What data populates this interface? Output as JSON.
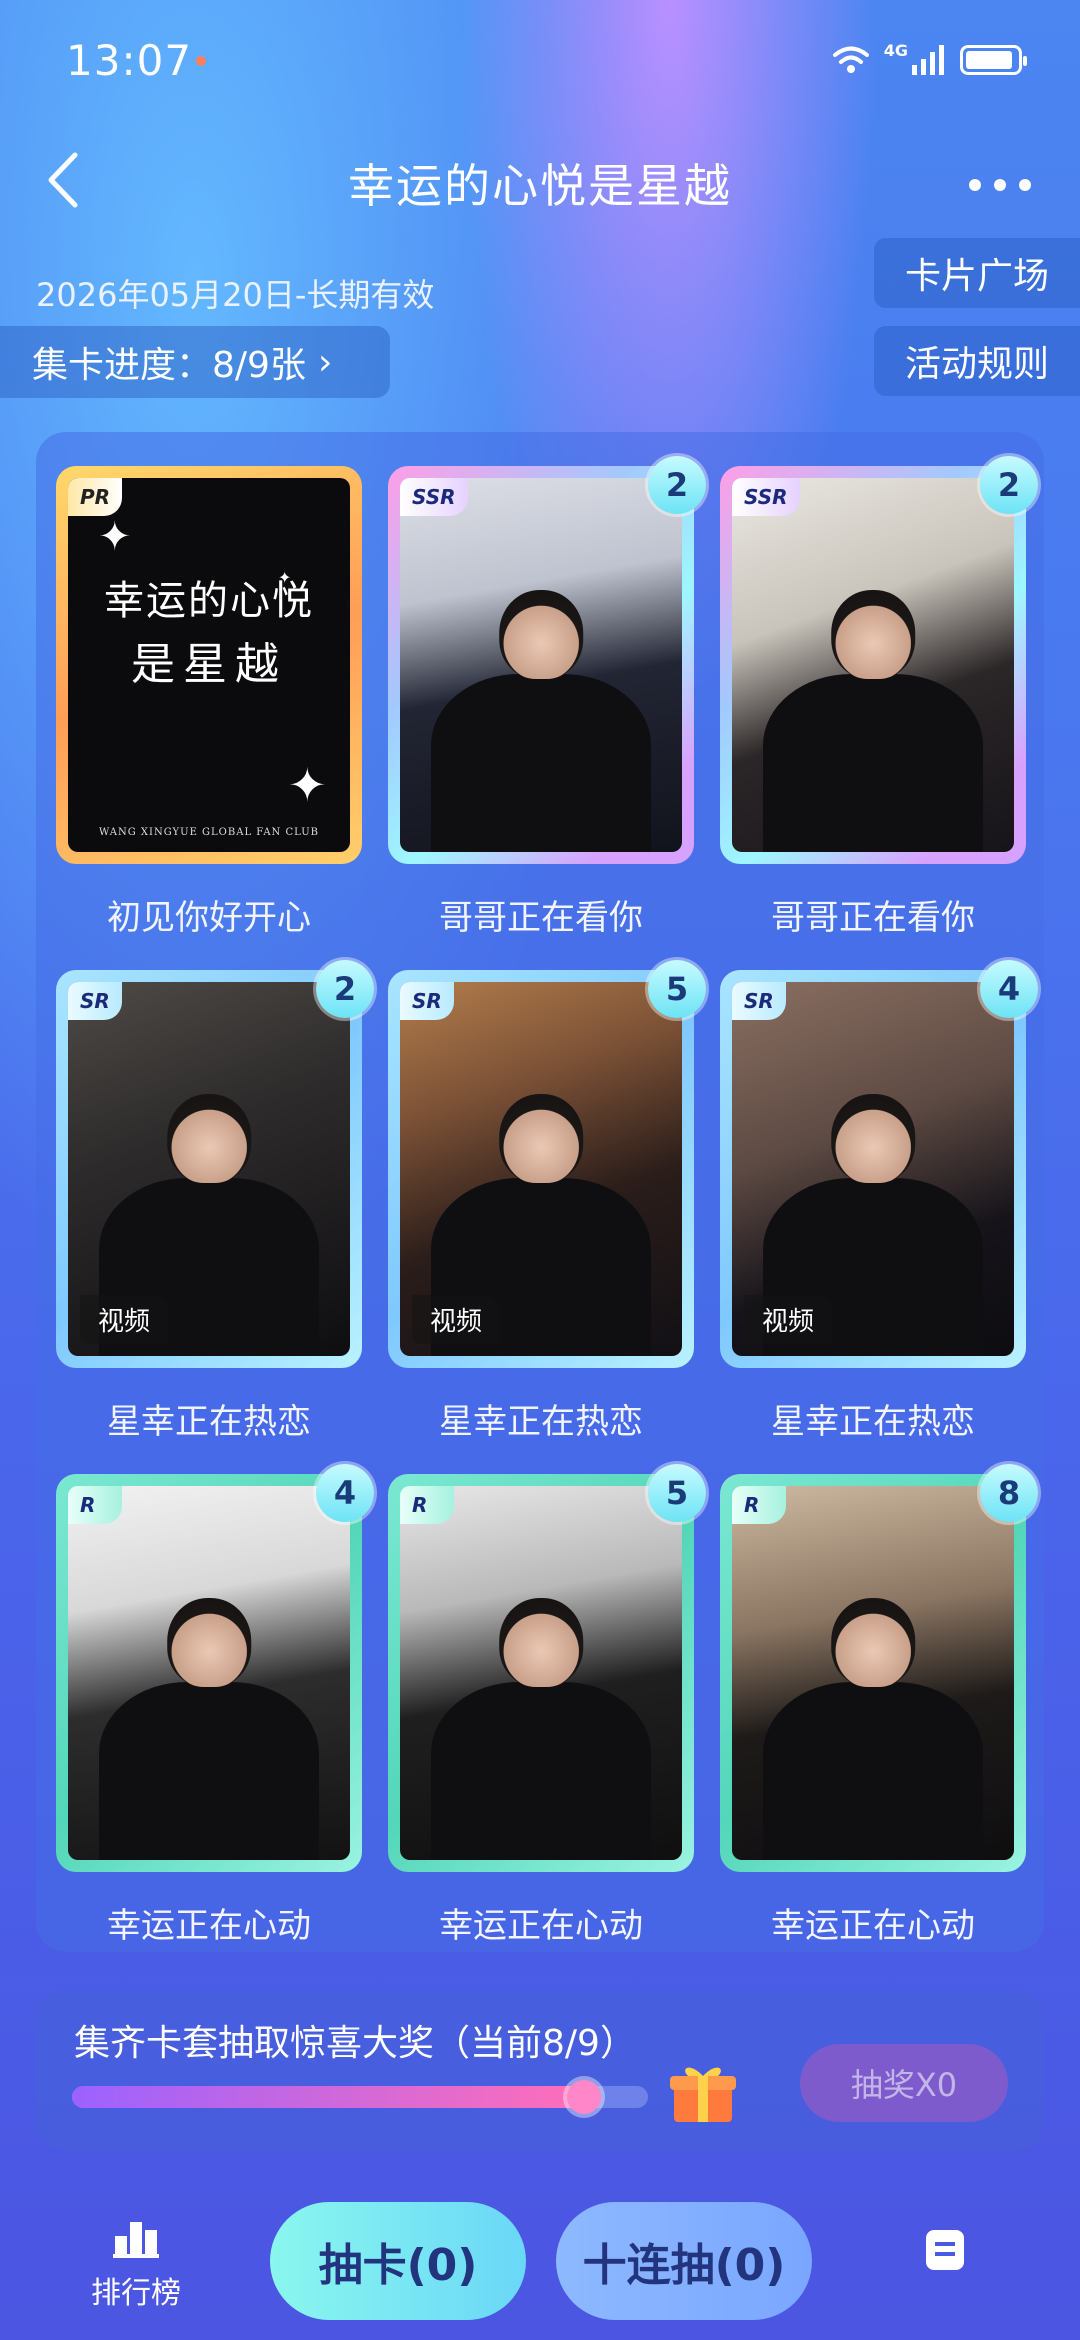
{
  "status_bar": {
    "time": "13:07",
    "network": "4G"
  },
  "header": {
    "title": "幸运的心悦是星越",
    "back_icon": "chevron-left-icon",
    "more_icon": "more-dots-icon"
  },
  "info": {
    "validity": "2026年05月20日-长期有效",
    "progress_label": "集卡进度：8/9张",
    "card_plaza": "卡片广场",
    "rules": "活动规则"
  },
  "cards": [
    {
      "rarity": "PR",
      "name": "初见你好开心",
      "count": "",
      "video": false,
      "calligraphy": [
        "幸运的心悦",
        "是星越"
      ],
      "fanclub": "WANG XINGYUE GLOBAL FAN CLUB"
    },
    {
      "rarity": "SSR",
      "name": "哥哥正在看你",
      "count": "2",
      "video": false
    },
    {
      "rarity": "SSR",
      "name": "哥哥正在看你",
      "count": "2",
      "video": false
    },
    {
      "rarity": "SR",
      "name": "星幸正在热恋",
      "count": "2",
      "video": true,
      "video_label": "视频"
    },
    {
      "rarity": "SR",
      "name": "星幸正在热恋",
      "count": "5",
      "video": true,
      "video_label": "视频"
    },
    {
      "rarity": "SR",
      "name": "星幸正在热恋",
      "count": "4",
      "video": true,
      "video_label": "视频"
    },
    {
      "rarity": "R",
      "name": "幸运正在心动",
      "count": "4",
      "video": false
    },
    {
      "rarity": "R",
      "name": "幸运正在心动",
      "count": "5",
      "video": false
    },
    {
      "rarity": "R",
      "name": "幸运正在心动",
      "count": "8",
      "video": false
    }
  ],
  "lottery": {
    "text": "集齐卡套抽取惊喜大奖（当前8/9）",
    "progress": 0.889,
    "button": "抽奖X0",
    "gift_icon": "gift-box-icon"
  },
  "bottom_nav": {
    "rank_label": "排行榜",
    "draw_one": "抽卡(0)",
    "draw_ten": "十连抽(0)",
    "rank_icon": "podium-icon",
    "note_icon": "note-icon"
  }
}
